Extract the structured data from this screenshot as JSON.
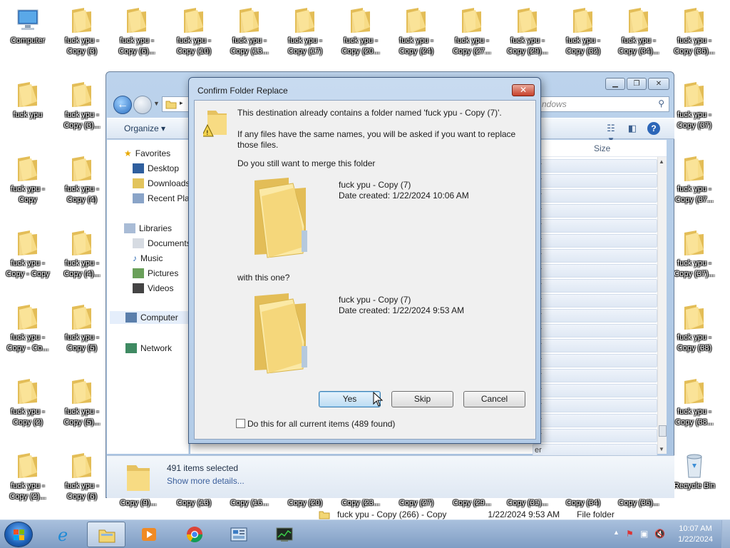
{
  "desktop": {
    "icons_top": [
      {
        "label": "Computer",
        "label2": "",
        "type": "computer"
      },
      {
        "label": "fuck ypu -",
        "label2": "Copy (3)",
        "type": "folder"
      },
      {
        "label": "fuck ypu -",
        "label2": "Copy (6)...",
        "type": "folder"
      },
      {
        "label": "fuck ypu -",
        "label2": "Copy (10)",
        "type": "folder"
      },
      {
        "label": "fuck ypu -",
        "label2": "Copy (13...",
        "type": "folder"
      },
      {
        "label": "fuck ypu -",
        "label2": "Copy (17)",
        "type": "folder"
      },
      {
        "label": "fuck ypu -",
        "label2": "Copy (20...",
        "type": "folder"
      },
      {
        "label": "fuck ypu -",
        "label2": "Copy (24)",
        "type": "folder"
      },
      {
        "label": "fuck ypu -",
        "label2": "Copy (27...",
        "type": "folder"
      },
      {
        "label": "fuck ypu -",
        "label2": "Copy (29)...",
        "type": "folder"
      },
      {
        "label": "fuck ypu -",
        "label2": "Copy (32)",
        "type": "folder"
      },
      {
        "label": "fuck ypu -",
        "label2": "Copy (34)...",
        "type": "folder"
      },
      {
        "label": "fuck ypu -",
        "label2": "Copy (36)...",
        "type": "folder"
      }
    ],
    "icons_col1": [
      {
        "label": "fuck ypu",
        "label2": ""
      },
      {
        "label": "fuck ypu -",
        "label2": "Copy"
      },
      {
        "label": "fuck ypu -",
        "label2": "Copy - Copy"
      },
      {
        "label": "fuck ypu -",
        "label2": "Copy - Co..."
      },
      {
        "label": "fuck ypu -",
        "label2": "Copy (2)"
      },
      {
        "label": "fuck ypu -",
        "label2": "Copy (2)..."
      }
    ],
    "icons_col2": [
      {
        "label": "fuck ypu -",
        "label2": "Copy (3)..."
      },
      {
        "label": "fuck ypu -",
        "label2": "Copy (4)"
      },
      {
        "label": "fuck ypu -",
        "label2": "Copy (4)..."
      },
      {
        "label": "fuck ypu -",
        "label2": "Copy (5)"
      },
      {
        "label": "fuck ypu -",
        "label2": "Copy (5)..."
      },
      {
        "label": "fuck ypu -",
        "label2": "Copy (6)"
      }
    ],
    "icons_right": [
      {
        "label": "fuck ypu -",
        "label2": "Copy (37)"
      },
      {
        "label": "fuck ypu -",
        "label2": "Copy (37..."
      },
      {
        "label": "fuck ypu -",
        "label2": "Copy (37)..."
      },
      {
        "label": "fuck ypu -",
        "label2": "Copy (38)"
      },
      {
        "label": "fuck ypu -",
        "label2": "Copy (38..."
      }
    ],
    "icons_bottom": [
      "Copy (9)...",
      "Copy (13)",
      "Copy (16...",
      "Copy (20)",
      "Copy (23...",
      "Copy (27)",
      "Copy (29...",
      "Copy (31)...",
      "Copy (34)",
      "Copy (36)..."
    ],
    "recycle_bin": "Recycle Bin"
  },
  "explorer": {
    "search_placeholder": "ndows",
    "toolbar": {
      "organize": "Organize ▾"
    },
    "column_size": "Size",
    "nav": {
      "favorites": "Favorites",
      "desktop": "Desktop",
      "downloads": "Downloads",
      "recent": "Recent Plac",
      "libraries": "Libraries",
      "documents": "Documents",
      "music": "Music",
      "pictures": "Pictures",
      "videos": "Videos",
      "computer": "Computer",
      "network": "Network"
    },
    "row_fragment": "er",
    "last_row": {
      "name": "fuck ypu - Copy (266) - Copy",
      "date": "1/22/2024 9:53 AM",
      "type": "File folder"
    },
    "details": {
      "count": "491 items selected",
      "more": "Show more details..."
    }
  },
  "dialog": {
    "title": "Confirm Folder Replace",
    "message": "This destination already contains a folder named 'fuck ypu - Copy (7)'.",
    "info1": "If any files have the same names, you will be asked if you want to replace",
    "info2": "those files.",
    "question": "Do you still want to merge this folder",
    "dest": {
      "name": "fuck ypu - Copy (7)",
      "date": "Date created: 1/22/2024 10:06 AM"
    },
    "with_text": "with this one?",
    "source": {
      "name": "fuck ypu - Copy (7)",
      "date": "Date created: 1/22/2024 9:53 AM"
    },
    "buttons": {
      "yes": "Yes",
      "skip": "Skip",
      "cancel": "Cancel"
    },
    "checkbox_label": "Do this for all current items (489 found)",
    "checkbox_checked": false
  },
  "taskbar": {
    "time": "10:07 AM",
    "date": "1/22/2024",
    "apps": [
      "internet-explorer",
      "file-explorer",
      "media-player",
      "chrome",
      "control-panel",
      "task-manager"
    ]
  },
  "colors": {
    "folder_yellow": "#f2d675",
    "folder_dark": "#e0b84a",
    "accent_blue": "#2c66b8"
  }
}
